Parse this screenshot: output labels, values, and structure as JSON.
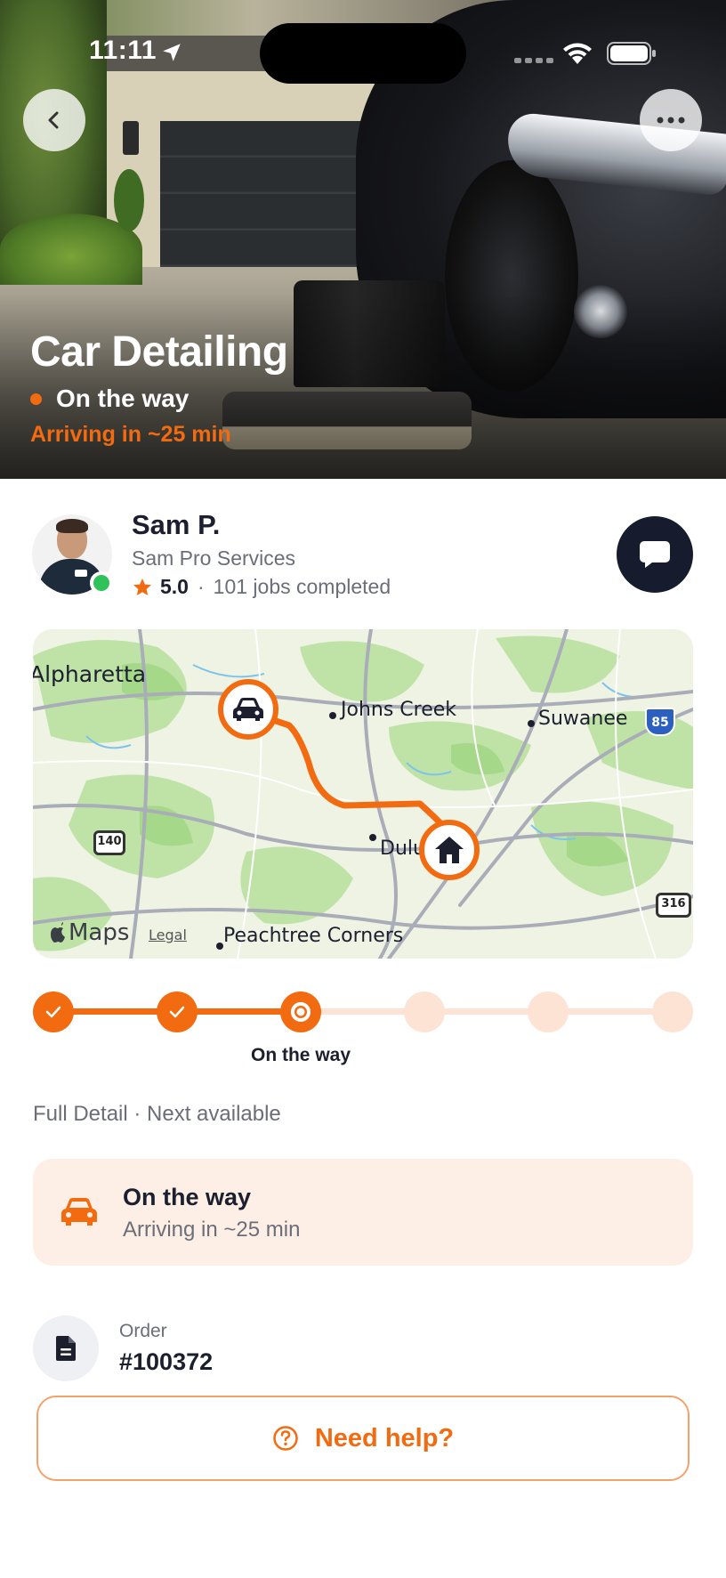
{
  "status_bar": {
    "time": "11:11"
  },
  "hero": {
    "title": "Car Detailing",
    "status": "On the way",
    "eta": "Arriving in ~25 min"
  },
  "provider": {
    "name": "Sam P.",
    "company": "Sam Pro Services",
    "rating": "5.0",
    "separator": "·",
    "jobs": "101 jobs completed"
  },
  "map": {
    "labels": {
      "alpharetta": "Alpharetta",
      "johns_creek": "Johns Creek",
      "suwanee": "Suwanee",
      "duluth": "Duluth",
      "peachtree": "Peachtree Corners"
    },
    "highways": {
      "h140": "140",
      "h316": "316",
      "i85": "85"
    },
    "brand": "Maps",
    "legal": "Legal"
  },
  "progress": {
    "total_steps": 6,
    "completed_steps": 2,
    "current_step": 3,
    "current_label": "On the way"
  },
  "service_line": "Full Detail · Next available",
  "status_card": {
    "title": "On the way",
    "subtitle": "Arriving in ~25 min"
  },
  "order": {
    "label": "Order",
    "number": "#100372"
  },
  "help_button": {
    "label": "Need help?"
  },
  "colors": {
    "accent": "#f26b10",
    "accent_light": "#fde3d3",
    "card_bg": "#fdefe5",
    "dark": "#161b2e",
    "online": "#2fc15a"
  }
}
